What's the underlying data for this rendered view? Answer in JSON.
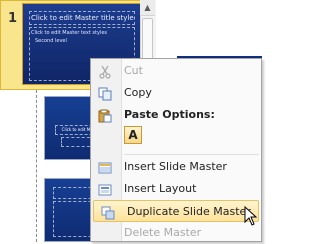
{
  "slide_pane": {
    "selected_slide_number": "1",
    "master_title_text": "Click to edit Master title style",
    "master_body_text": "Click to edit Master text styles",
    "master_body_sub": "Second level",
    "layout_title_text": "Click to edit Master title style"
  },
  "context_menu": {
    "items": [
      {
        "label": "Cut",
        "icon": "scissors-icon",
        "disabled": true
      },
      {
        "label": "Copy",
        "icon": "copy-icon",
        "disabled": false
      },
      {
        "label": "Paste Options:",
        "icon": "paste-icon",
        "disabled": false,
        "header": true
      },
      {
        "label": "Insert Slide Master",
        "icon": "insert-slide-master-icon",
        "disabled": false
      },
      {
        "label": "Insert Layout",
        "icon": "insert-layout-icon",
        "disabled": false
      },
      {
        "label": "Duplicate Slide Master",
        "icon": "duplicate-icon",
        "disabled": false,
        "highlighted": true
      },
      {
        "label": "Delete Master",
        "icon": "delete-icon",
        "disabled": true
      }
    ],
    "paste_option_label": "A"
  },
  "colors": {
    "selection_bg": "#f8e58c",
    "menu_highlight": "#fde29a",
    "slide_blue": "#1d3d8f"
  }
}
